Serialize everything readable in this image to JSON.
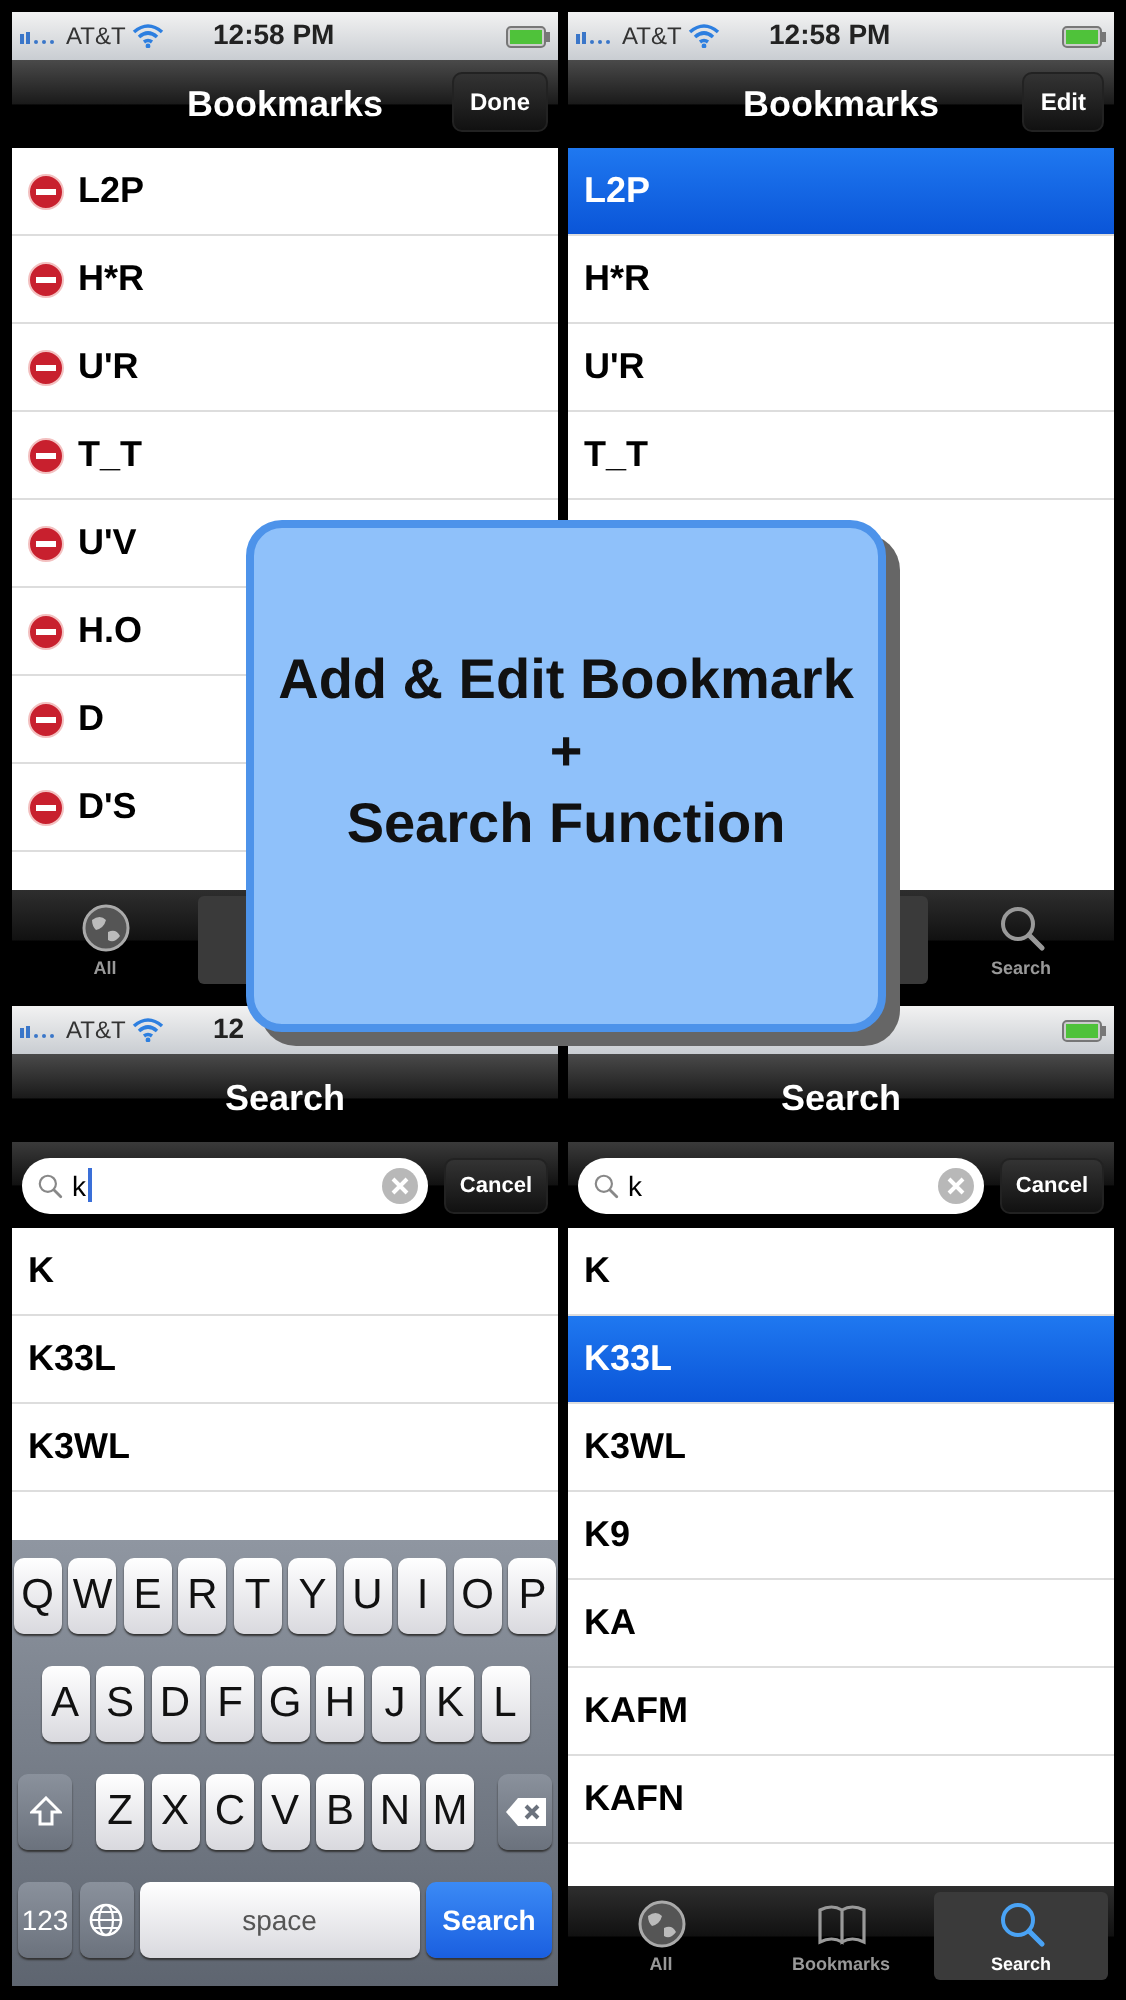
{
  "screens": [
    {
      "kind": "bookmarks",
      "status": {
        "carrier": "AT&T",
        "time": "12:58 PM"
      },
      "title": "Bookmarks",
      "nav_button": "Done",
      "editing": true,
      "rows": [
        {
          "label": "L2P",
          "selected": false
        },
        {
          "label": "H*R",
          "selected": false
        },
        {
          "label": "U'R",
          "selected": false
        },
        {
          "label": "T_T",
          "selected": false
        },
        {
          "label": "U'V",
          "selected": false
        },
        {
          "label": "H.O",
          "selected": false
        },
        {
          "label": "D",
          "selected": false
        },
        {
          "label": "D'S",
          "selected": false
        }
      ],
      "tabs": [
        {
          "label": "All",
          "selected": false
        },
        {
          "selected": true
        },
        {
          "selected": false
        }
      ]
    },
    {
      "kind": "bookmarks",
      "status": {
        "carrier": "AT&T",
        "time": "12:58 PM"
      },
      "title": "Bookmarks",
      "nav_button": "Edit",
      "editing": false,
      "rows": [
        {
          "label": "L2P",
          "selected": true
        },
        {
          "label": "H*R",
          "selected": false
        },
        {
          "label": "U'R",
          "selected": false
        },
        {
          "label": "T_T",
          "selected": false
        }
      ],
      "tabs": [
        {
          "selected": false
        },
        {
          "selected": true
        },
        {
          "label": "Search",
          "selected": false
        }
      ]
    },
    {
      "kind": "search",
      "status": {
        "carrier": "AT&T",
        "time": "12"
      },
      "title": "Search",
      "search": {
        "value": "k",
        "focused": true
      },
      "cancel": "Cancel",
      "rows": [
        {
          "label": "K",
          "selected": false
        },
        {
          "label": "K33L",
          "selected": false
        },
        {
          "label": "K3WL",
          "selected": false
        }
      ],
      "keyboard": {
        "rows": [
          [
            "Q",
            "W",
            "E",
            "R",
            "T",
            "Y",
            "U",
            "I",
            "O",
            "P"
          ],
          [
            "A",
            "S",
            "D",
            "F",
            "G",
            "H",
            "J",
            "K",
            "L"
          ],
          [
            "Z",
            "X",
            "C",
            "V",
            "B",
            "N",
            "M"
          ]
        ],
        "number_key": "123",
        "space": "space",
        "action": "Search"
      }
    },
    {
      "kind": "search",
      "title": "Search",
      "search": {
        "value": "k",
        "focused": false
      },
      "cancel": "Cancel",
      "rows": [
        {
          "label": "K",
          "selected": false
        },
        {
          "label": "K33L",
          "selected": true
        },
        {
          "label": "K3WL",
          "selected": false
        },
        {
          "label": "K9",
          "selected": false
        },
        {
          "label": "KA",
          "selected": false
        },
        {
          "label": "KAFM",
          "selected": false
        },
        {
          "label": "KAFN",
          "selected": false
        }
      ],
      "tabs": [
        {
          "label": "All",
          "selected": false
        },
        {
          "label": "Bookmarks",
          "selected": false
        },
        {
          "label": "Search",
          "selected": true
        }
      ]
    }
  ],
  "callout": {
    "lines": [
      "Add & Edit Bookmark",
      "+",
      "Search Function"
    ]
  }
}
